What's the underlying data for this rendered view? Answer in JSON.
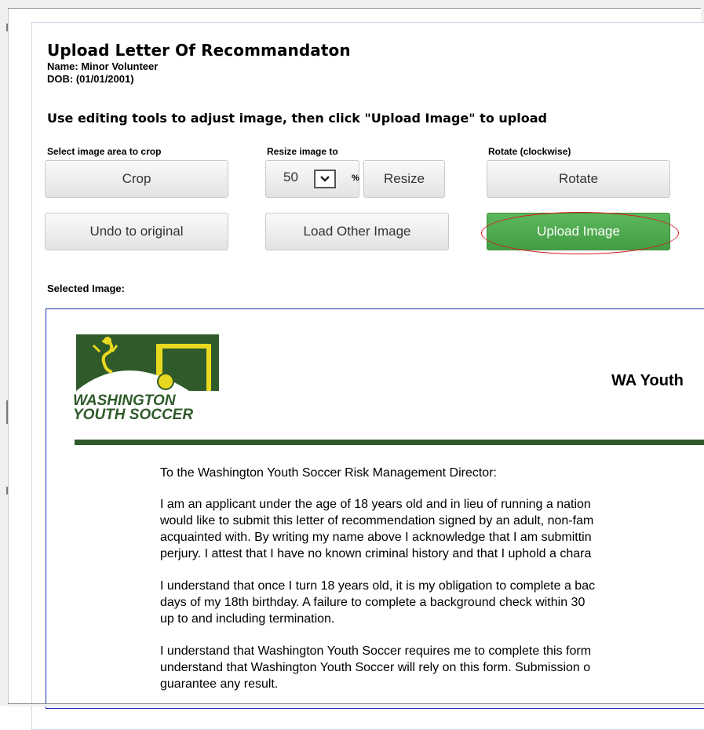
{
  "dialog": {
    "title": "Upload Letter Of Recommandaton",
    "name_line": "Name: Minor Volunteer",
    "dob_line": "DOB: (01/01/2001)",
    "instructions": "Use editing tools to adjust image, then click \"Upload Image\" to upload"
  },
  "tools": {
    "crop_label": "Select image area to crop",
    "crop_button": "Crop",
    "resize_label": "Resize image to",
    "resize_value": "50",
    "resize_unit": "%",
    "resize_button": "Resize",
    "rotate_label": "Rotate (clockwise)",
    "rotate_button": "Rotate",
    "undo_button": "Undo to original",
    "load_button": "Load Other Image",
    "upload_button": "Upload Image"
  },
  "selected_image": {
    "label": "Selected Image:",
    "logo_text_line1": "WASHINGTON",
    "logo_text_line2": "YOUTH SOCCER",
    "heading": "WA Youth",
    "paragraphs": [
      [
        "To the Washington Youth Soccer Risk Management Director:"
      ],
      [
        "I am an applicant under the age of 18 years old and in lieu of running a nation",
        "would like to submit this letter of recommendation signed by an adult, non-fam",
        "acquainted with. By writing my name above I acknowledge that I am submittin",
        "perjury. I attest that I have no known criminal history and that I uphold a chara"
      ],
      [
        "I understand that once I turn 18 years old, it is my obligation to complete a bac",
        "days of my 18th birthday. A failure to complete a background check within 30",
        "up to and including termination."
      ],
      [
        "I understand that Washington Youth Soccer requires me to complete this form",
        "understand that Washington Youth Soccer will rely on this form. Submission o",
        "guarantee any result."
      ]
    ]
  },
  "colors": {
    "upload_green": "#4cae4c",
    "highlight_red": "#d9161c",
    "frame_blue": "#1f2fb0",
    "logo_green": "#2f5a2a",
    "logo_yellow": "#e8d81f"
  }
}
